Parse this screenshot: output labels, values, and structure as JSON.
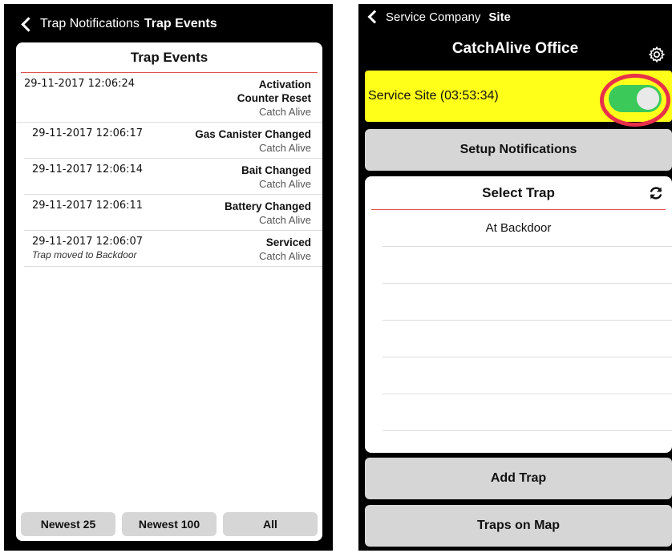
{
  "left": {
    "nav": {
      "back_label": "Trap Notifications",
      "title": "Trap Events"
    },
    "card_title": "Trap Events",
    "events": [
      {
        "datetime": "29-11-2017 12:06:24",
        "titles": [
          "Activation",
          "Counter Reset"
        ],
        "source": "Catch Alive",
        "note": ""
      },
      {
        "datetime": "29-11-2017 12:06:17",
        "titles": [
          "Gas Canister Changed"
        ],
        "source": "Catch Alive",
        "note": ""
      },
      {
        "datetime": "29-11-2017 12:06:14",
        "titles": [
          "Bait Changed"
        ],
        "source": "Catch Alive",
        "note": ""
      },
      {
        "datetime": "29-11-2017 12:06:11",
        "titles": [
          "Battery Changed"
        ],
        "source": "Catch Alive",
        "note": ""
      },
      {
        "datetime": "29-11-2017 12:06:07",
        "titles": [
          "Serviced"
        ],
        "source": "Catch Alive",
        "note": "Trap moved to Backdoor"
      }
    ],
    "buttons": [
      "Newest 25",
      "Newest 100",
      "All"
    ]
  },
  "right": {
    "nav": {
      "back_label": "Service Company",
      "title": "Site"
    },
    "header_title": "CatchAlive Office",
    "service_label": "Service Site (03:53:34)",
    "service_toggle_on": true,
    "setup_label": "Setup Notifications",
    "select_title": "Select Trap",
    "traps": [
      "At Backdoor",
      "",
      "",
      "",
      "",
      ""
    ],
    "add_label": "Add Trap",
    "map_label": "Traps on Map"
  },
  "colors": {
    "toggle_on": "#3bc95a",
    "service_bar": "#ffff1a",
    "highlight": "#e8304b",
    "divider_red": "#d9534f",
    "button_gray": "#d6d6d6"
  },
  "icons": [
    "back-chevron-icon",
    "gear-icon",
    "refresh-icon"
  ]
}
